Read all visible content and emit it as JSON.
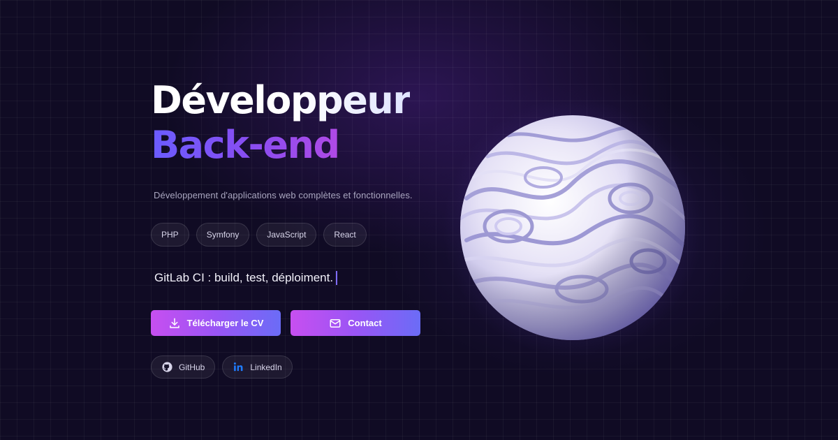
{
  "hero": {
    "title_line1": "Développeur",
    "title_line2": "Back-end",
    "subtitle": "Développement d'applications web complètes et fonctionnelles."
  },
  "tags": [
    "PHP",
    "Symfony",
    "JavaScript",
    "React"
  ],
  "typing_text": "GitLab CI : build, test, déploiment.",
  "actions": {
    "download_cv_label": "Télécharger le CV",
    "contact_label": "Contact"
  },
  "socials": {
    "github_label": "GitHub",
    "linkedin_label": "LinkedIn"
  },
  "icons": {
    "download": "download-icon",
    "contact": "mail-icon",
    "github": "github-icon",
    "linkedin": "linkedin-icon"
  },
  "colors": {
    "background": "#100b24",
    "accent_start": "#c74ff0",
    "accent_end": "#6b6cf6",
    "title_gradient_start": "#6a5cff",
    "title_gradient_end": "#b04ae6",
    "linkedin_blue": "#1f7cff"
  }
}
